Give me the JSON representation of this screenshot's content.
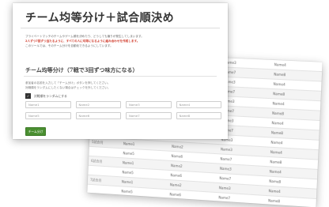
{
  "page": {
    "title": "チーム均等分け＋試合順決め",
    "description_lines": [
      "プライベートマッチのチームやゲーム順を決めたり、どうしても偏りが発生してしまいます。",
      "2人ずつ7回ずつ当たるように、すべての人に均等になるように組み合わせを作成します。",
      "このツールでは、そのチーム分けを自動化できるようにしています。"
    ],
    "description_highlight": "7回ずつ当たるように、すべての人に均等になるように"
  },
  "section": {
    "title": "チーム均等分け（7戦で3回ずつ味方になる）",
    "desc_lines": [
      "参加者の名前を入力して「チーム分け」ボタンを押してください。",
      "対戦順をランダムにしたくない場合はチェックを外してください。"
    ],
    "checkbox_label": "対戦順をランダムにする",
    "checkbox_checked": true,
    "name_placeholders": [
      "Name1",
      "Name2",
      "Name3",
      "Name4",
      "Name5",
      "Name6",
      "Name7",
      "Name8"
    ],
    "button_label": "チーム分け"
  },
  "schedule": {
    "rows": [
      {
        "round": "",
        "cells": [
          "Name1",
          "Name2",
          "Name3",
          "Name4"
        ]
      },
      {
        "round": "",
        "cells": [
          "Name5",
          "Name6",
          "Name7",
          "Name8"
        ]
      },
      {
        "round": "",
        "cells": [
          "Name1",
          "Name2",
          "Name3",
          "Name4"
        ]
      },
      {
        "round": "",
        "cells": [
          "Name5",
          "Name6",
          "Name7",
          "Name8"
        ]
      },
      {
        "round": "",
        "cells": [
          "Name1",
          "Name2",
          "Name3",
          "Name4"
        ]
      },
      {
        "round": "",
        "cells": [
          "Name5",
          "Name6",
          "Name7",
          "Name8"
        ]
      },
      {
        "round": "",
        "cells": [
          "Name1",
          "Name2",
          "Name3",
          "Name4"
        ]
      },
      {
        "round": "",
        "cells": [
          "Name5",
          "Name6",
          "Name7",
          "Name8"
        ]
      },
      {
        "round": "",
        "cells": [
          "Name1",
          "Name2",
          "Name3",
          "Name4"
        ]
      },
      {
        "round": "5試合目",
        "cells": [
          "Name1",
          "Name2",
          "Name3",
          "Name4"
        ]
      },
      {
        "round": "",
        "cells": [
          "Name5",
          "Name6",
          "Name7",
          "Name8"
        ]
      },
      {
        "round": "6試合目",
        "cells": [
          "Name1",
          "Name2",
          "Name3",
          "Name4"
        ]
      },
      {
        "round": "",
        "cells": [
          "Name5",
          "Name6",
          "Name7",
          "Name8"
        ]
      },
      {
        "round": "7試合目",
        "cells": [
          "Name1",
          "Name2",
          "Name3",
          "Name4"
        ]
      },
      {
        "round": "",
        "cells": [
          "Name5",
          "Name6",
          "Name7",
          "Name8"
        ]
      }
    ]
  }
}
